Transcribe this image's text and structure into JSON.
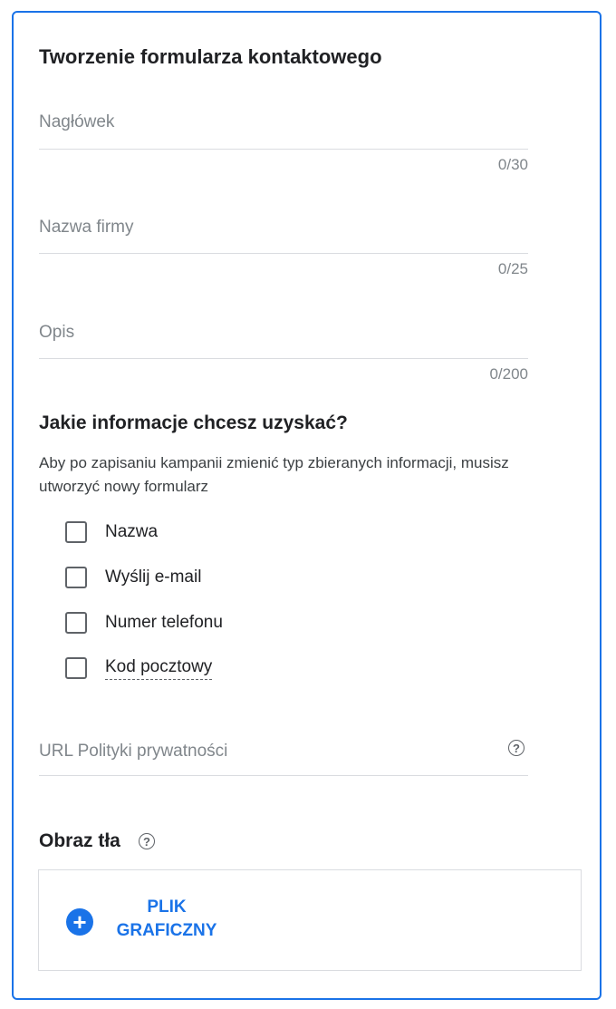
{
  "form": {
    "title": "Tworzenie formularza kontaktowego",
    "fields": [
      {
        "label": "Nagłówek",
        "counter": "0/30"
      },
      {
        "label": "Nazwa firmy",
        "counter": "0/25"
      },
      {
        "label": "Opis",
        "counter": "0/200"
      }
    ],
    "info_section": {
      "title": "Jakie informacje chcesz uzyskać?",
      "description": "Aby po zapisaniu kampanii zmienić typ zbieranych informacji, musisz utworzyć nowy formularz",
      "options": [
        {
          "label": "Nazwa",
          "checked": false
        },
        {
          "label": "Wyślij e-mail",
          "checked": false
        },
        {
          "label": "Numer telefonu",
          "checked": false
        },
        {
          "label": "Kod pocztowy",
          "checked": false
        }
      ]
    },
    "privacy_url": {
      "label": "URL Polityki prywatności",
      "help_icon": "question-mark-icon"
    },
    "background_image": {
      "title": "Obraz tła",
      "help_icon": "question-mark-icon",
      "upload_label_line1": "PLIK",
      "upload_label_line2": "GRAFICZNY",
      "upload_icon": "plus-circle-icon"
    }
  },
  "colors": {
    "accent": "#1a73e8",
    "muted": "#80868b",
    "divider": "#dadce0"
  }
}
